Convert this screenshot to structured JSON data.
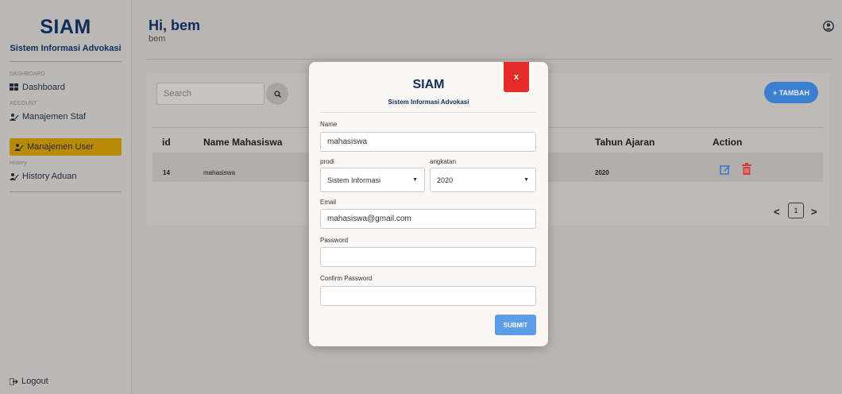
{
  "sidebar": {
    "brand_title": "SIAM",
    "brand_subtitle": "Sistem Informasi Advokasi",
    "sections": [
      "DASHBOARD",
      "ACCOUNT",
      "History"
    ],
    "items": [
      {
        "label": "Dashboard",
        "icon": "grid-icon"
      },
      {
        "label": "Manajemen Staf",
        "icon": "users-icon"
      },
      {
        "label": "Manajemen User",
        "icon": "users-icon",
        "active": true
      },
      {
        "label": "History Aduan",
        "icon": "users-icon"
      }
    ],
    "logout_label": "Logout",
    "active_color": "#b98a07"
  },
  "header": {
    "greeting": "Hi, bem",
    "username": "bem"
  },
  "main": {
    "search_placeholder": "Search",
    "add_button": "+ TAMBAH",
    "columns": [
      "id",
      "Name Mahasiswa",
      "Tahun Ajaran",
      "Action"
    ],
    "rows": [
      {
        "id": "14",
        "name": "mahasiswa",
        "tahun_ajaran": "2020"
      }
    ],
    "pagination": {
      "prev": "<",
      "page": "1",
      "next": ">"
    }
  },
  "modal": {
    "title": "SIAM",
    "subtitle": "Sistem Informasi Advokasi",
    "close_label": "x",
    "name_label": "Name",
    "name_value": "mahasiswa",
    "prodi_label": "prodi",
    "prodi_value": "Sistem Informasi",
    "angkatan_label": "angkatan",
    "angkatan_value": "2020",
    "email_label": "Email",
    "email_value": "mahasiswa@gmail.com",
    "password_label": "Password",
    "password_value": "",
    "confirm_label": "Confirm Password",
    "confirm_value": "",
    "submit_label": "SUBMIT"
  },
  "colors": {
    "brand": "#0f2d5a",
    "close": "#e52a2a",
    "submit": "#5b9de9",
    "add": "#3c7fd0",
    "delete": "#d83a3a",
    "edit": "#3a78c8"
  }
}
